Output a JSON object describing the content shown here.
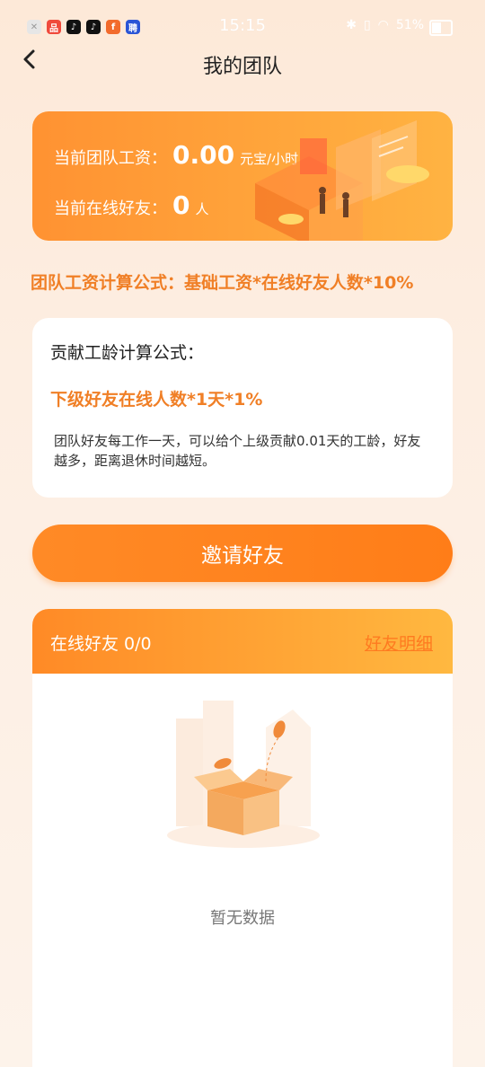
{
  "status_bar": {
    "time": "15:15",
    "battery": "51%"
  },
  "header": {
    "title": "我的团队"
  },
  "salary_card": {
    "team_salary_label": "当前团队工资：",
    "team_salary_value": "0.00",
    "team_salary_unit": "元宝/小时",
    "online_friends_label": "当前在线好友：",
    "online_friends_value": "0",
    "online_friends_unit": "人"
  },
  "team_formula": "团队工资计算公式：基础工资*在线好友人数*10%",
  "contribution": {
    "title": "贡献工龄计算公式：",
    "formula": "下级好友在线人数*1天*1%",
    "description": "团队好友每工作一天，可以给个上级贡献0.01天的工龄，好友越多，距离退休时间越短。"
  },
  "invite_button": "邀请好友",
  "friends_panel": {
    "title": "在线好友 0/0",
    "detail_link": "好友明细",
    "empty_text": "暂无数据"
  },
  "colors": {
    "accent": "#ff8a26",
    "accent_text": "#f07f26"
  }
}
